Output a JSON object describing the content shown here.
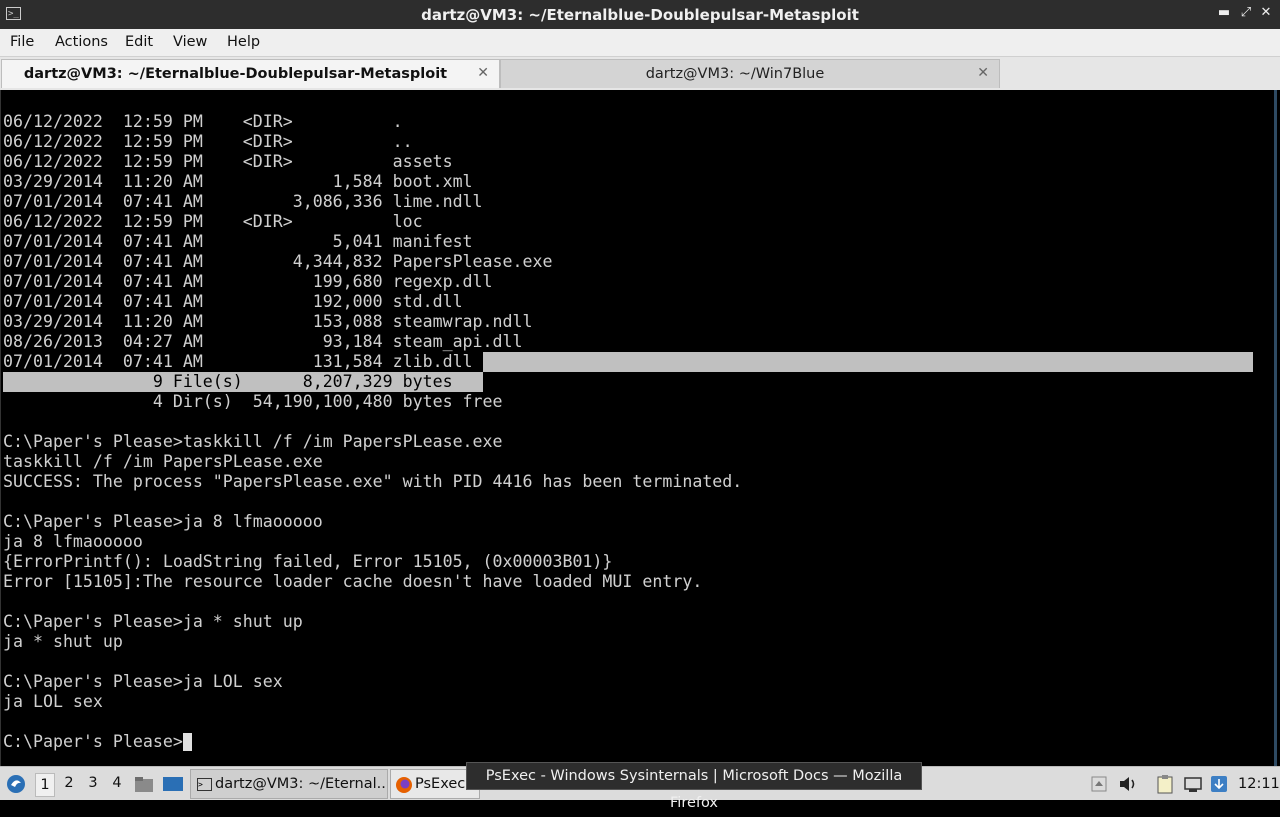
{
  "window": {
    "title": "dartz@VM3: ~/Eternalblue-Doublepulsar-Metasploit"
  },
  "menu": [
    "File",
    "Actions",
    "Edit",
    "View",
    "Help"
  ],
  "tabs": [
    {
      "label": "dartz@VM3: ~/Eternalblue-Doublepulsar-Metasploit",
      "active": true
    },
    {
      "label": "dartz@VM3: ~/Win7Blue",
      "active": false
    }
  ],
  "terminal": {
    "lines": [
      "06/12/2022  12:59 PM    <DIR>          .",
      "06/12/2022  12:59 PM    <DIR>          ..",
      "06/12/2022  12:59 PM    <DIR>          assets",
      "03/29/2014  11:20 AM             1,584 boot.xml",
      "07/01/2014  07:41 AM         3,086,336 lime.ndll",
      "06/12/2022  12:59 PM    <DIR>          loc",
      "07/01/2014  07:41 AM             5,041 manifest",
      "07/01/2014  07:41 AM         4,344,832 PapersPlease.exe",
      "07/01/2014  07:41 AM           199,680 regexp.dll",
      "07/01/2014  07:41 AM           192,000 std.dll",
      "03/29/2014  11:20 AM           153,088 steamwrap.ndll",
      "08/26/2013  04:27 AM            93,184 steam_api.dll",
      "07/01/2014  07:41 AM           131,584 zlib.dll",
      "               9 File(s)      8,207,329 bytes",
      "               4 Dir(s)  54,190,100,480 bytes free",
      "",
      "C:\\Paper's Please>taskkill /f /im PapersPLease.exe",
      "taskkill /f /im PapersPLease.exe",
      "SUCCESS: The process \"PapersPlease.exe\" with PID 4416 has been terminated.",
      "",
      "C:\\Paper's Please>ja 8 lfmaooooo",
      "ja 8 lfmaooooo",
      "{ErrorPrintf(): LoadString failed, Error 15105, (0x00003B01)}",
      "Error [15105]:The resource loader cache doesn't have loaded MUI entry.",
      "",
      "C:\\Paper's Please>ja * shut up",
      "ja * shut up",
      "",
      "C:\\Paper's Please>ja LOL sex",
      "ja LOL sex",
      "",
      "C:\\Paper's Please>"
    ]
  },
  "taskbar": {
    "workspaces": [
      "1",
      "2",
      "3",
      "4"
    ],
    "active_workspace": "1",
    "tasks": [
      {
        "label": "dartz@VM3: ~/Eternal..."
      },
      {
        "label": "PsExec"
      }
    ],
    "tooltip": "PsExec - Windows Sysinternals | Microsoft Docs — Mozilla Firefox",
    "clock": "12:11"
  },
  "icons": [
    "terminal-icon",
    "minimize-icon",
    "maximize-icon",
    "close-icon",
    "start-menu-icon",
    "file-manager-icon",
    "show-desktop-icon",
    "firefox-icon",
    "volume-icon",
    "clipboard-icon",
    "network-icon"
  ]
}
